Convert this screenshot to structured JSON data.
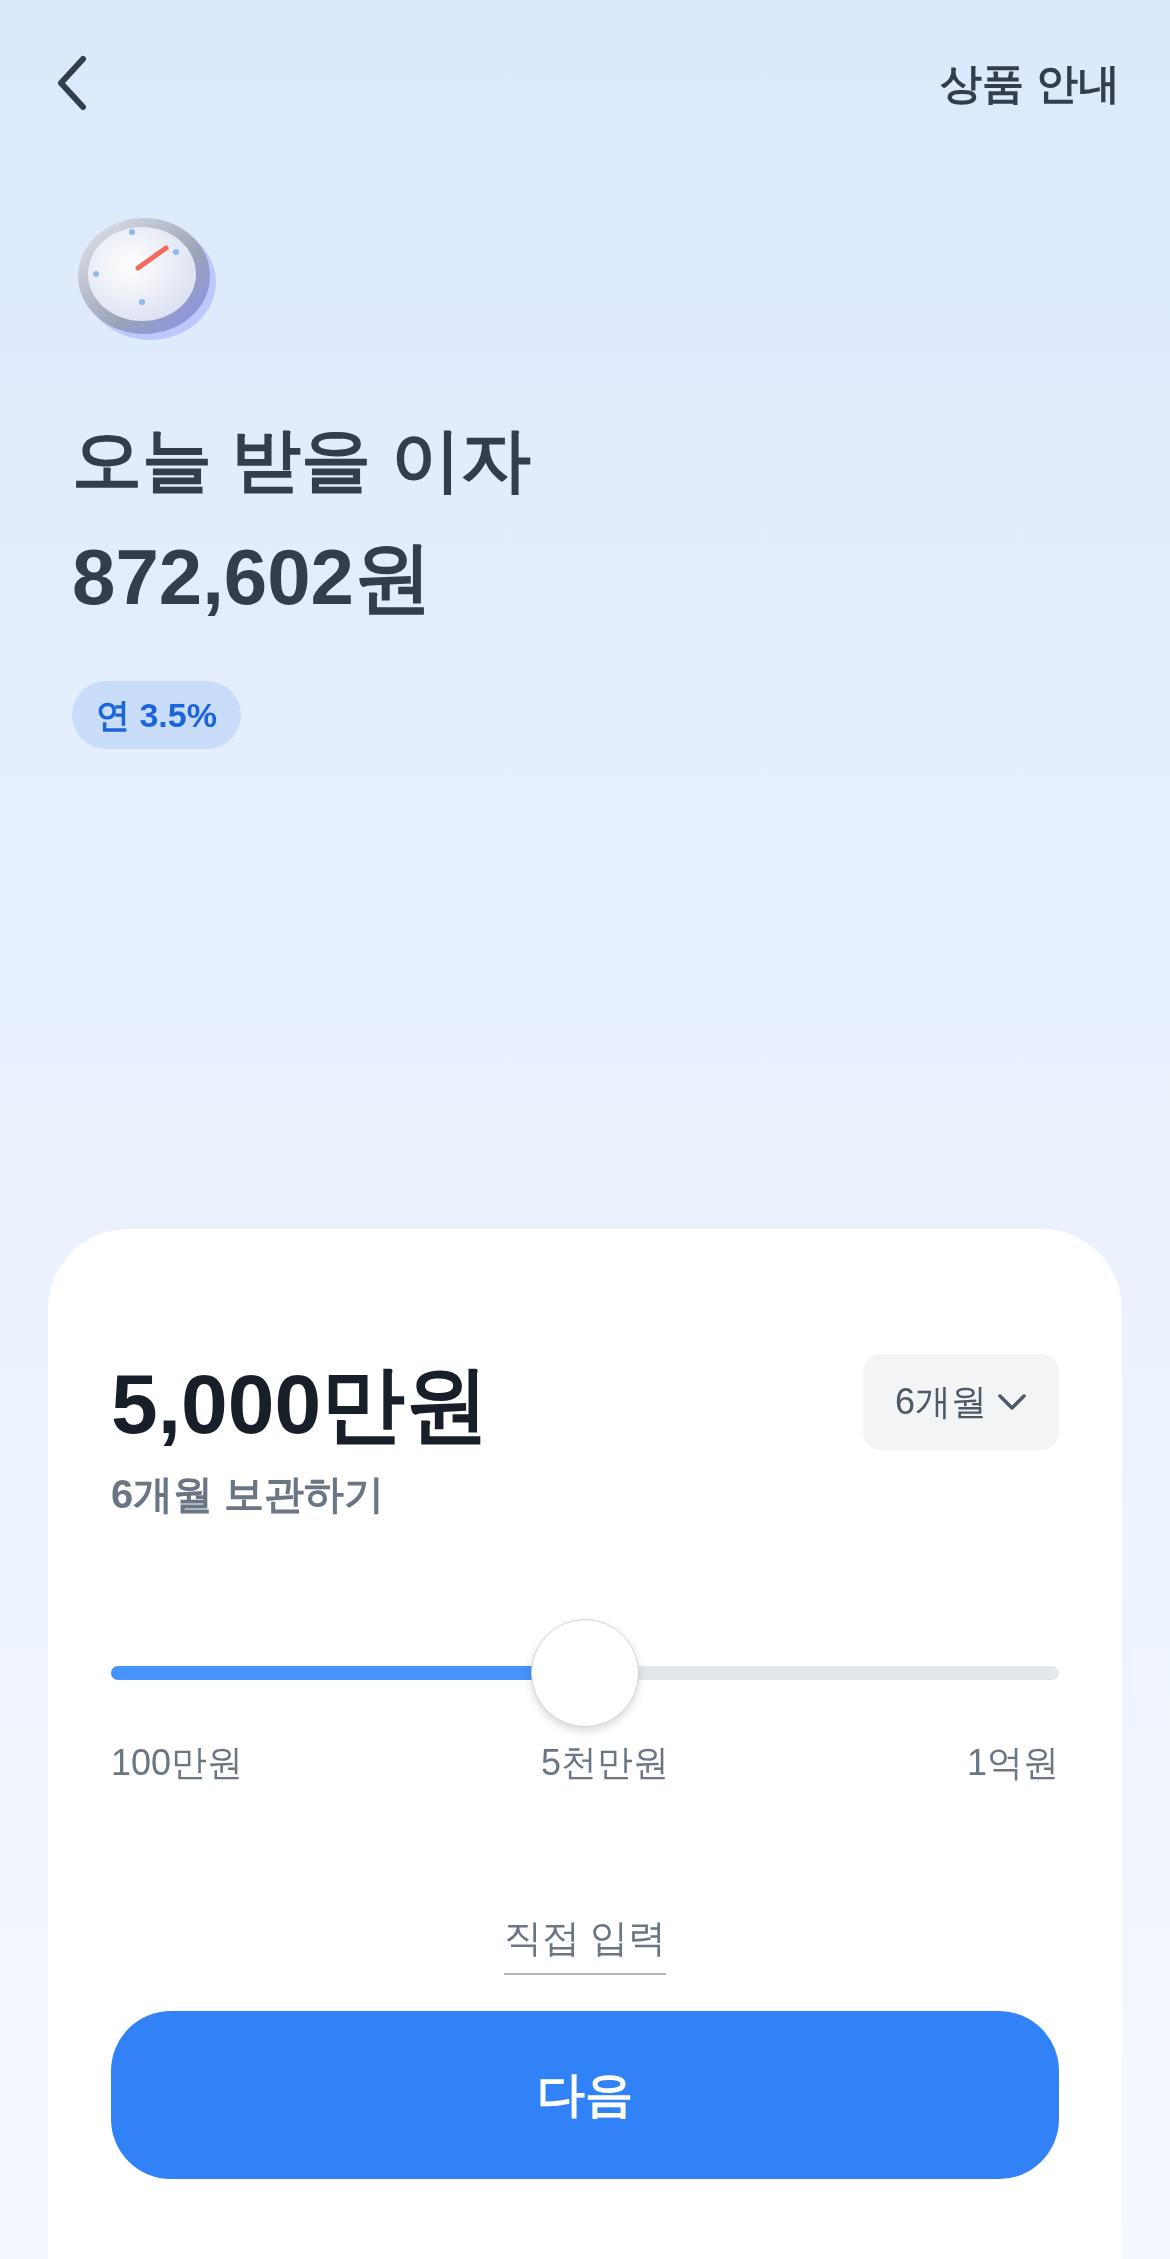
{
  "header": {
    "link": "상품 안내"
  },
  "hero": {
    "title": "오늘 받을 이자",
    "amount": "872,602원",
    "rate_badge": "연 3.5%"
  },
  "card": {
    "amount": "5,000만원",
    "subtitle": "6개월 보관하기",
    "period_dropdown": "6개월",
    "slider": {
      "level": 0.5,
      "labels": [
        "100만원",
        "5천만원",
        "1억원"
      ]
    },
    "direct_input": "직접 입력",
    "next_button": "다음"
  }
}
